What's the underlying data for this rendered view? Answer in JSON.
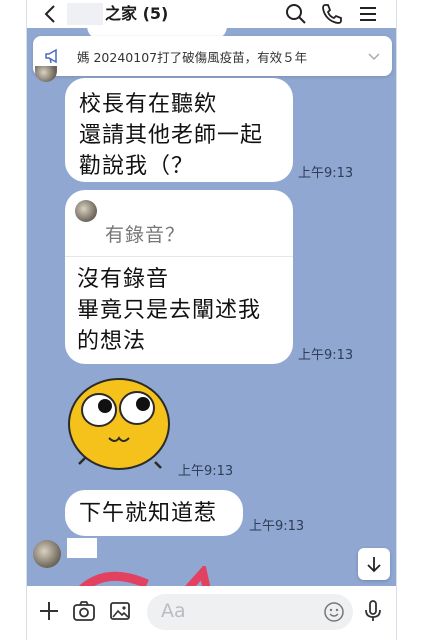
{
  "header": {
    "title": "之家 (5)"
  },
  "announcement": {
    "text": "媽 20240107打了破傷風疫苗，有效５年"
  },
  "messages": [
    {
      "lines": [
        "校長有在聽欸",
        "還請其他老師一起",
        "勸說我（？"
      ],
      "time": "上午9:13"
    },
    {
      "quote": "有錄音？",
      "lines": [
        "沒有錄音",
        "畢竟只是去闡述我",
        "的想法"
      ],
      "time": "上午9:13"
    },
    {
      "sticker": "googly-eyes-emoji",
      "time": "上午9:13"
    },
    {
      "lines": [
        "下午就知道惹"
      ],
      "time": "上午9:13"
    }
  ],
  "input": {
    "placeholder": "Aa"
  },
  "colors": {
    "chat_background": "#8fa7d1",
    "bubble": "#ffffff",
    "sticker_yellow": "#f4c21a"
  }
}
